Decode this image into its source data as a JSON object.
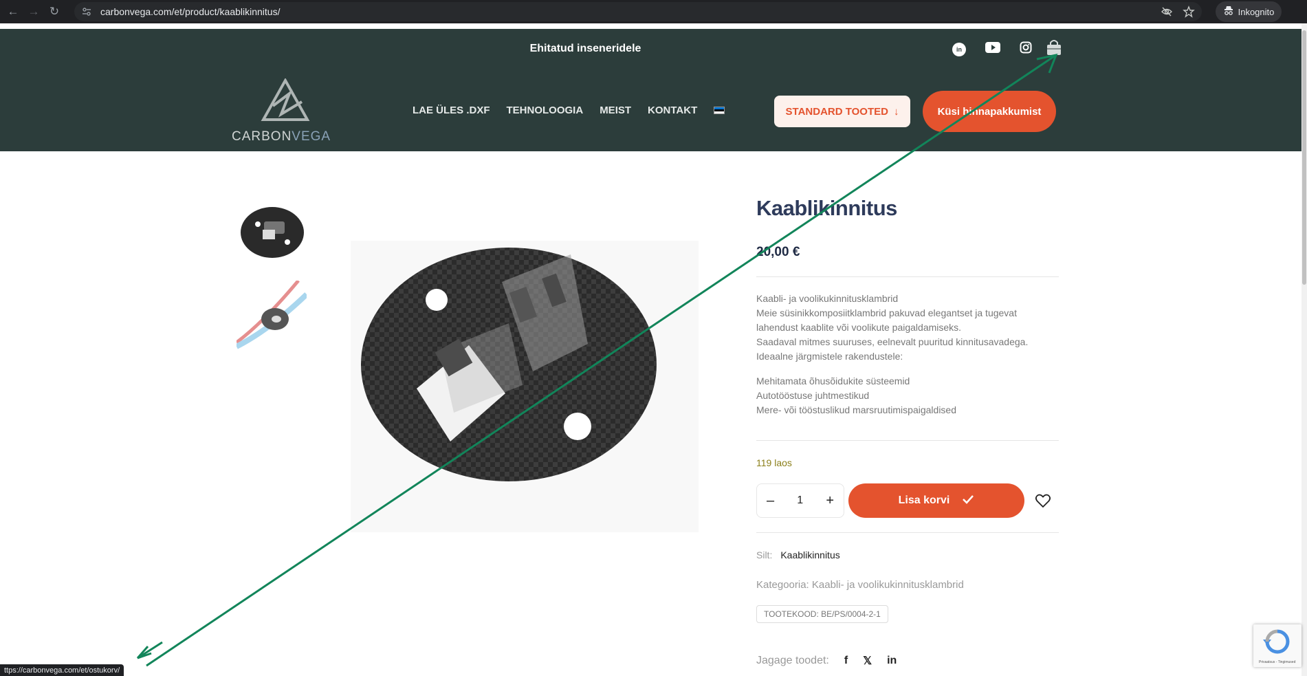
{
  "browser": {
    "url": "carbonvega.com/et/product/kaablikinnitus/",
    "profile_label": "Inkognito",
    "status_url": "ttps://carbonvega.com/et/ostukorv/"
  },
  "header": {
    "tagline": "Ehitatud inseneridele",
    "logo": {
      "text_main": "CARBON",
      "text_accent": "VEGA"
    },
    "social": [
      "linkedin-icon",
      "youtube-icon",
      "instagram-icon"
    ],
    "nav": [
      "LAE ÜLES .DXF",
      "TEHNOLOOGIA",
      "MEIST",
      "KONTAKT"
    ],
    "language_flag": {
      "colors": [
        "#0072ce",
        "#000000",
        "#ffffff"
      ]
    },
    "standard_button": "STANDARD TOOTED",
    "quote_button": "Küsi hinnapakkumist"
  },
  "product": {
    "title": "Kaablikinnitus",
    "price": "20,00 €",
    "description": [
      "Kaabli- ja voolikukinnitusklambrid",
      "Meie süsinikkomposiitklambrid pakuvad elegantset ja tugevat",
      "lahendust kaablite või voolikute paigaldamiseks.",
      "Saadaval mitmes suuruses, eelnevalt puuritud kinnitusavadega.",
      "Ideaalne järgmistele rakendustele:"
    ],
    "applications": [
      "Mehitamata õhusõidukite süsteemid",
      "Autotööstuse juhtmestikud",
      "Mere- või tööstuslikud marsruutimispaigaldised"
    ],
    "stock": "119 laos",
    "quantity": "1",
    "add_to_cart": "Lisa korvi",
    "tag_label": "Silt:",
    "tag_value": "Kaablikinnitus",
    "category": "Kategooria: Kaabli- ja voolikukinnitusklambrid",
    "sku": "TOOTEKOOD: BE/PS/0004-2-1",
    "share_label": "Jagage toodet:",
    "share_icons": [
      "facebook-icon",
      "x-icon",
      "linkedin-icon"
    ]
  },
  "recaptcha": {
    "text": "Privaatsus - Tingimused"
  },
  "colors": {
    "header_bg": "#2c3d3b",
    "accent": "#e4532e",
    "annotation": "#12855a"
  }
}
